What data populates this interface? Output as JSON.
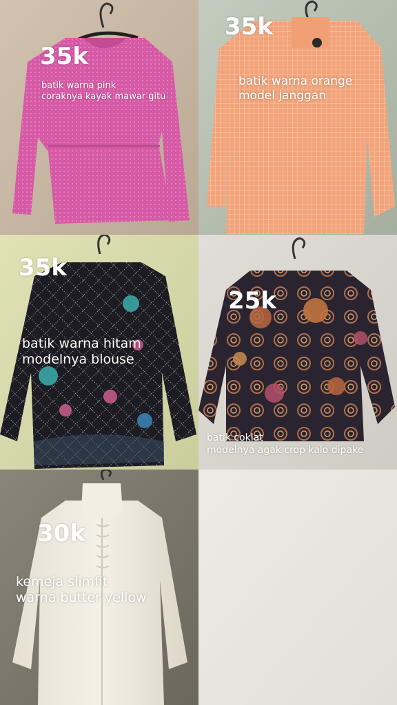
{
  "items": [
    {
      "price": "35k",
      "desc_line1": "batik warna pink",
      "desc_line2": "coraknya kayak mawar gitu",
      "garment_color": "#d65aa6",
      "background_color": "#c9b8a4"
    },
    {
      "price": "35k",
      "desc_line1": "batik warna orange",
      "desc_line2": "model janggan",
      "garment_color": "#f2a37a",
      "background_color": "#b3bdb0"
    },
    {
      "price": "35k",
      "desc_line1": "batik warna hitam",
      "desc_line2": "modelnya blouse",
      "garment_color": "#1c1c22",
      "background_color": "#d9dcae"
    },
    {
      "price": "25k",
      "desc_line1": "batik coklat",
      "desc_line2": "modelnya agak crop kalo dipake",
      "garment_color": "#2a2430",
      "background_color": "#d8d6cf"
    },
    {
      "price": "30k",
      "desc_line1": "kemeja slimfit",
      "desc_line2": "warna butter yellow",
      "garment_color": "#efeadf",
      "background_color": "#7d786c"
    }
  ],
  "empty_cell_color": "#e9e6e2"
}
